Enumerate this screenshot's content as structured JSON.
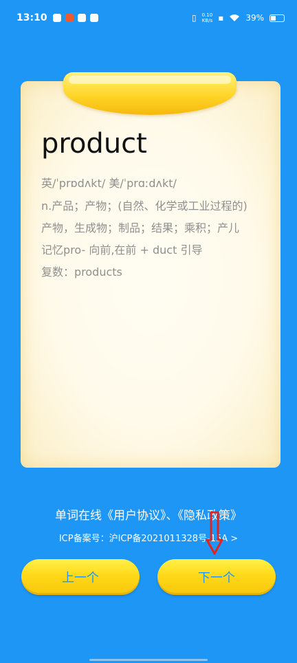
{
  "status_bar": {
    "time": "13:10",
    "network_speed_value": "0.10",
    "network_speed_unit": "KB/s",
    "battery": "39%"
  },
  "card": {
    "word": "product",
    "phonetic": "英/ˈprɒdʌkt/ 美/ˈprɑːdʌkt/",
    "definition_1": "n.产品；产物；(自然、化学或工业过程的)",
    "definition_2": "产物，生成物；制品；结果；乘积；产儿",
    "memory": "记忆pro- 向前,在前 + duct 引导",
    "plural": "复数：products"
  },
  "footer": {
    "agreement": "单词在线《用户协议》、《隐私政策》",
    "icp": "ICP备案号：沪ICP备2021011328号-15A >"
  },
  "buttons": {
    "prev": "上一个",
    "next": "下一个"
  },
  "colors": {
    "background": "#1e96f5",
    "button_yellow": "#ffd919",
    "annotation_arrow": "#e0241f"
  }
}
